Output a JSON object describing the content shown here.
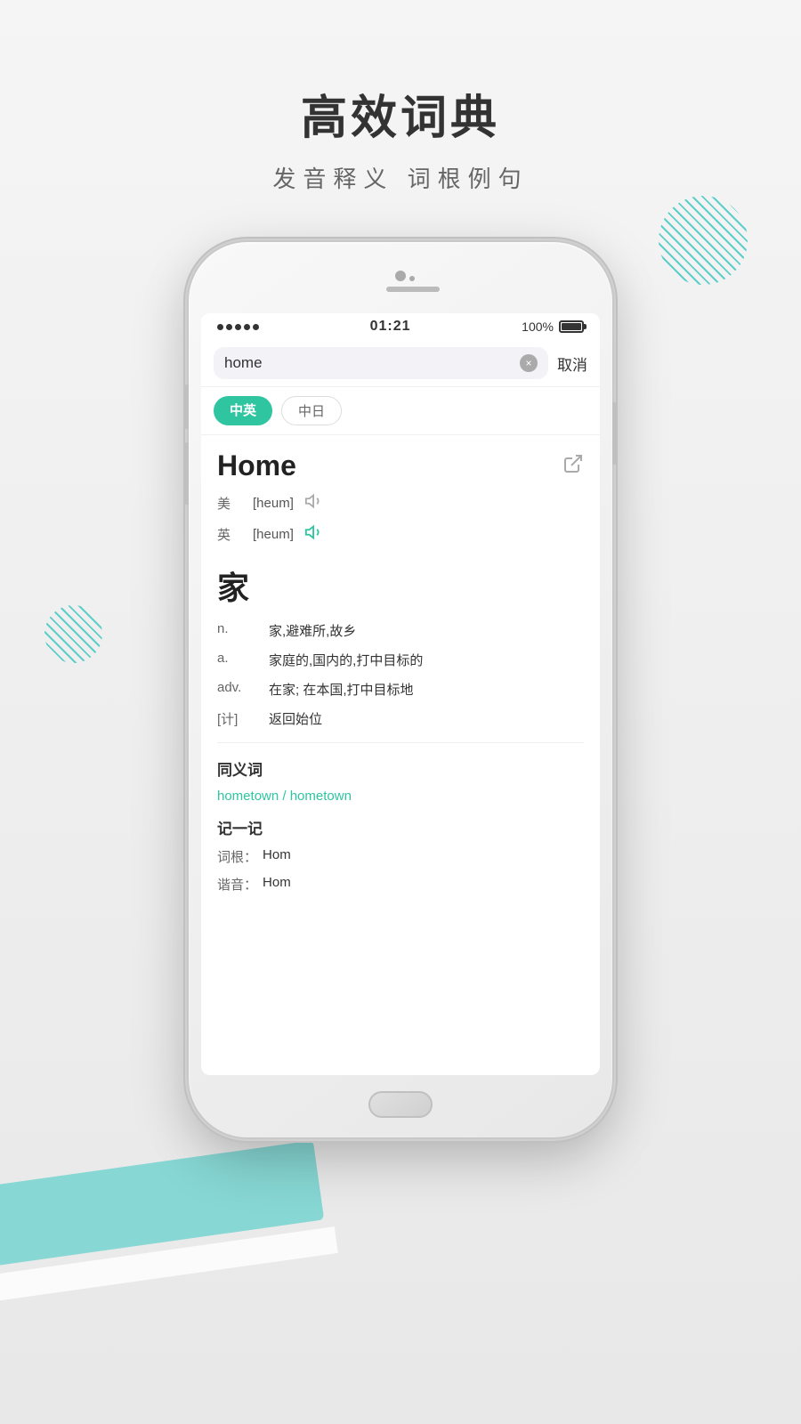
{
  "page": {
    "bg_color": "#f2f2f0"
  },
  "header": {
    "title": "高效词典",
    "subtitle": "发音释义  词根例句"
  },
  "phone": {
    "status_bar": {
      "signal": "•••••",
      "time": "01:21",
      "battery": "100%"
    },
    "search": {
      "query": "home",
      "clear_label": "×",
      "cancel_label": "取消"
    },
    "tabs": [
      {
        "label": "中英",
        "active": true
      },
      {
        "label": "中日",
        "active": false
      }
    ],
    "entry": {
      "word": "Home",
      "us_label": "美",
      "us_pron": "[heum]",
      "uk_label": "英",
      "uk_pron": "[heum]",
      "chinese_char": "家",
      "definitions": [
        {
          "pos": "n.",
          "text": "家,避难所,故乡"
        },
        {
          "pos": "a.",
          "text": "家庭的,国内的,打中目标的"
        },
        {
          "pos": "adv.",
          "text": "在家; 在本国,打中目标地"
        },
        {
          "pos": "[计]",
          "text": "返回始位"
        }
      ],
      "synonyms_title": "同义词",
      "synonyms": "hometown / hometown",
      "memory_title": "记一记",
      "root_label": "词根：",
      "root_value": "Hom",
      "sound_label": "谐音：",
      "sound_value": "Hom"
    }
  }
}
